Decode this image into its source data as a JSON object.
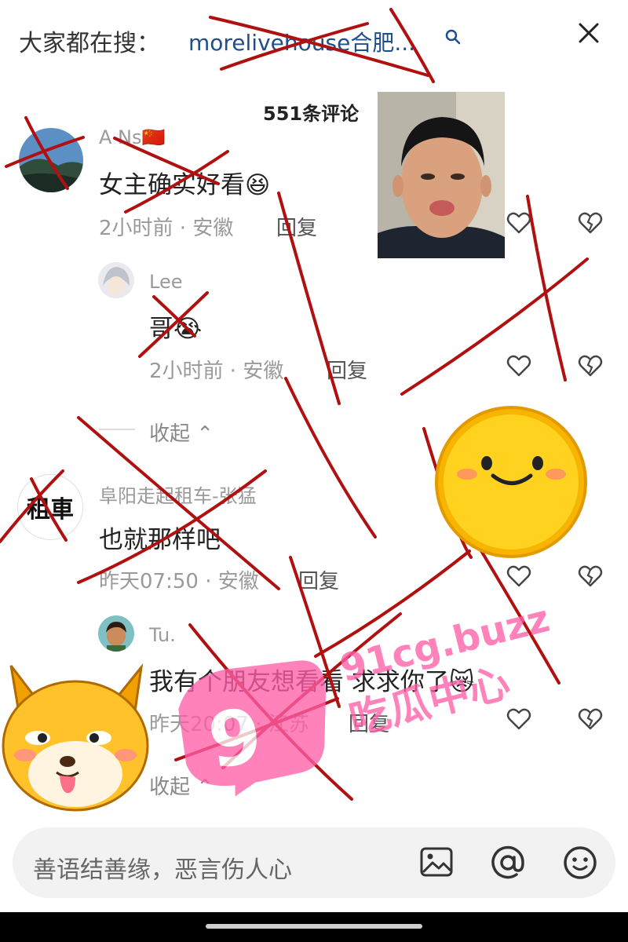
{
  "search": {
    "prefix": "大家都在搜：",
    "term": "morelivehouse合肥..."
  },
  "comments_header": {
    "count": "551条评论"
  },
  "comments": [
    {
      "name": "A Ns🇨🇳",
      "text": "女主确实好看😆",
      "meta": "2小时前 · 安徽",
      "reply": "回复"
    },
    {
      "name": "Lee",
      "text": "哥😭",
      "meta": "2小时前 · 安徽",
      "reply": "回复"
    },
    {
      "collapse": "收起"
    },
    {
      "name": "阜阳走起租车-张猛",
      "avatar_text": "租車",
      "text": "也就那样吧",
      "meta": "昨天07:50 · 安徽",
      "reply": "回复"
    },
    {
      "name": "Tu.",
      "text": "我有个朋友想看看 求求你了😿",
      "meta": "昨天20:07 · 江苏",
      "reply": "回复"
    },
    {
      "collapse": "收起"
    }
  ],
  "input": {
    "placeholder": "善语结善缘，恶言伤人心"
  },
  "watermark": {
    "line1": "91cg.buzz",
    "line2": "吃瓜中心"
  },
  "colors": {
    "accent_blue": "#1f4e8c",
    "scribble_red": "#b01010",
    "watermark_pink": "#ff5fa8"
  }
}
